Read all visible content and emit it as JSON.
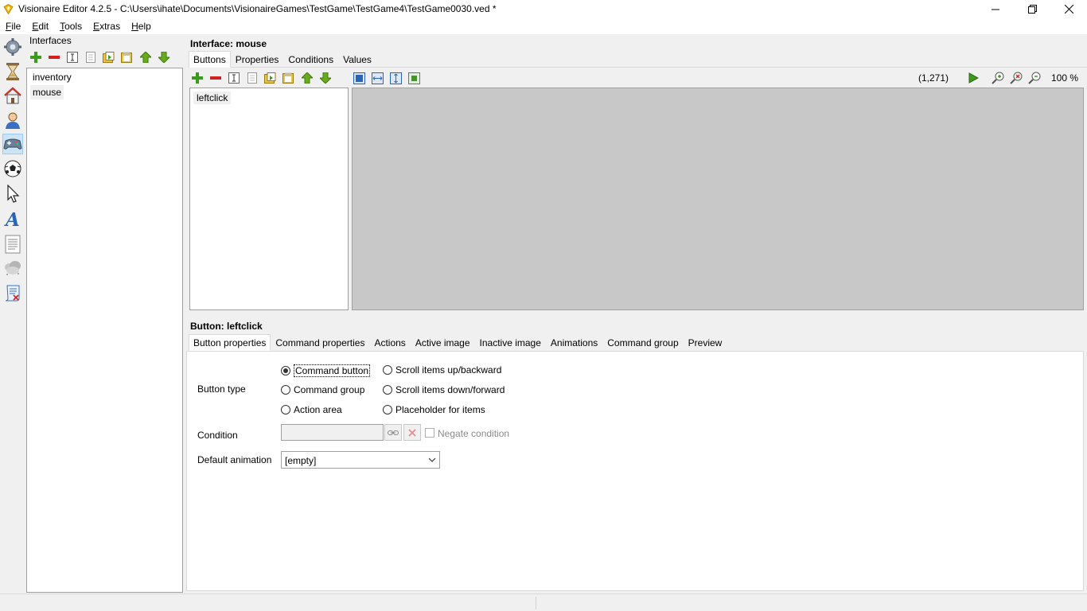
{
  "window": {
    "title": "Visionaire Editor 4.2.5 - C:\\Users\\ihate\\Documents\\VisionaireGames\\TestGame\\TestGame4\\TestGame0030.ved *",
    "controls": [
      "minimize",
      "maximize",
      "close"
    ]
  },
  "menu": {
    "items": [
      {
        "label": "File",
        "mnemonic": "F",
        "rest": "ile"
      },
      {
        "label": "Edit",
        "mnemonic": "E",
        "rest": "dit"
      },
      {
        "label": "Tools",
        "mnemonic": "T",
        "rest": "ools"
      },
      {
        "label": "Extras",
        "mnemonic": "E",
        "rest": "xtras"
      },
      {
        "label": "Help",
        "mnemonic": "H",
        "rest": "elp"
      }
    ]
  },
  "sidebar": {
    "icons": [
      "settings-icon",
      "hourglass-icon",
      "scene-home-icon",
      "character-icon",
      "gamepad-icon",
      "ball-icon",
      "cursor-icon",
      "font-icon",
      "text-icon",
      "particles-icon",
      "script-icon"
    ],
    "active": "gamepad-icon"
  },
  "interfaces": {
    "title": "Interfaces",
    "items": [
      "inventory",
      "mouse"
    ],
    "selected": "mouse"
  },
  "interface": {
    "header": "Interface: mouse",
    "tabs": [
      "Buttons",
      "Properties",
      "Conditions",
      "Values"
    ],
    "active_tab": "Buttons",
    "coords": "(1,271)",
    "zoom": "100 %",
    "buttons": [
      "leftclick"
    ]
  },
  "button": {
    "header": "Button: leftclick",
    "tabs": [
      "Button properties",
      "Command properties",
      "Actions",
      "Active image",
      "Inactive image",
      "Animations",
      "Command group",
      "Preview"
    ],
    "active_tab": "Button properties",
    "button_type_label": "Button type",
    "types": [
      {
        "label": "Command button",
        "checked": true
      },
      {
        "label": "Command group",
        "checked": false
      },
      {
        "label": "Action area",
        "checked": false
      },
      {
        "label": "Scroll items up/backward",
        "checked": false
      },
      {
        "label": "Scroll items down/forward",
        "checked": false
      },
      {
        "label": "Placeholder for items",
        "checked": false
      }
    ],
    "condition_label": "Condition",
    "condition_value": "",
    "negate_label": "Negate condition",
    "negate_checked": false,
    "default_animation_label": "Default animation",
    "default_animation_value": "[empty]"
  },
  "colors": {
    "accent_selected": "#cce4f7",
    "canvas_bg": "#c8c8c8",
    "green_icon": "#3c9a1e",
    "red_icon": "#d21f1f"
  }
}
